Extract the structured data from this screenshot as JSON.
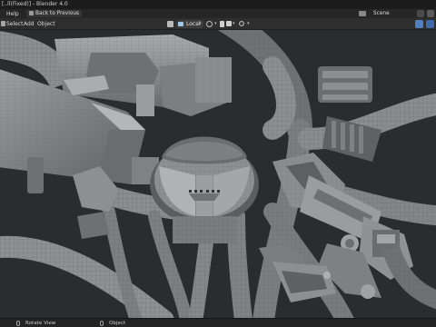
{
  "titlebar": {
    "text": "[..ll(Fixed)] - Blender 4.0"
  },
  "topbar": {
    "menu_help": "Help",
    "back_button": "Back to Previous",
    "scene_label": "Scene"
  },
  "header": {
    "menus": [
      "Select",
      "Add",
      "Object"
    ],
    "orientation": {
      "label": "Local",
      "icon": "transform-orientation-icon"
    }
  },
  "status": {
    "items": [
      {
        "icon": "mouse-middle-icon",
        "label": "Rotate View"
      },
      {
        "icon": "mouse-right-icon",
        "label": "Object"
      }
    ]
  },
  "colors": {
    "background": "#3a3a3a",
    "header": "#2e2e2e",
    "accent": "#4f7fc0",
    "mesh": "#8d8f91"
  }
}
